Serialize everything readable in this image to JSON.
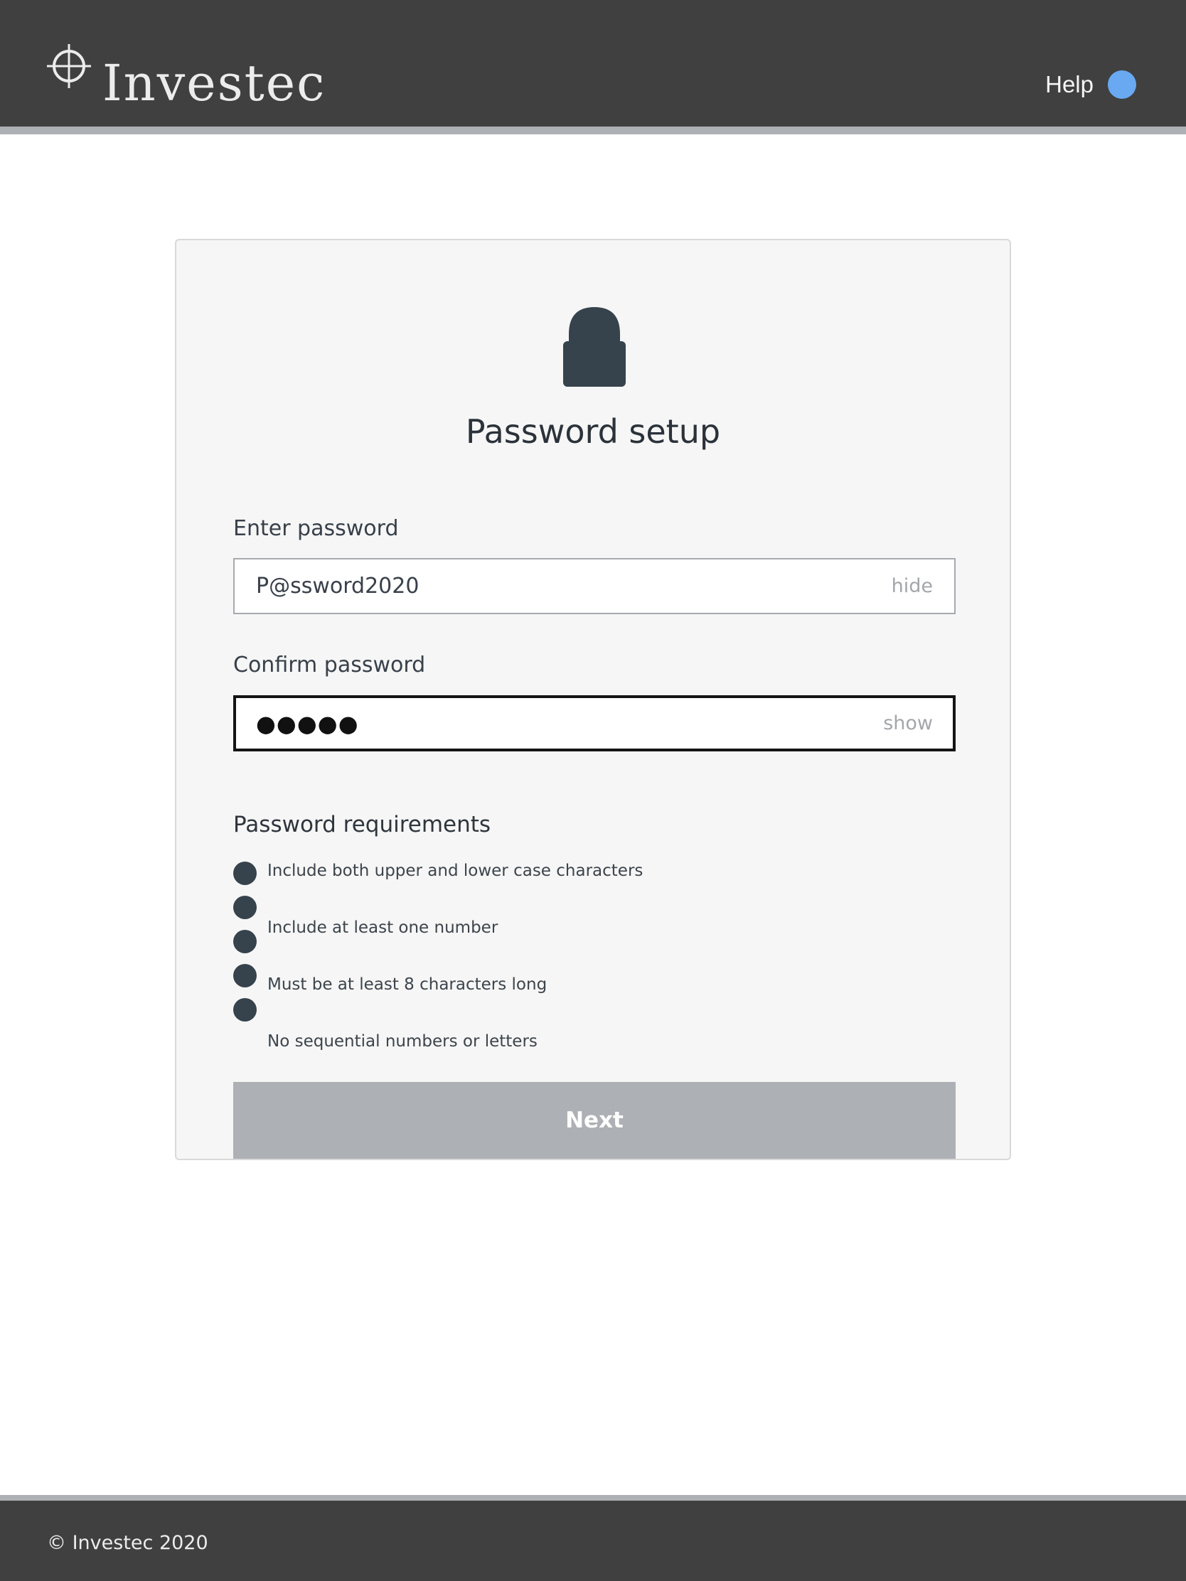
{
  "header": {
    "brand": "Investec",
    "help_label": "Help",
    "help_icon": "info-dot",
    "accent": "#69a9f2"
  },
  "card": {
    "icon": "lock-icon",
    "title": "Password setup",
    "password": {
      "label": "Enter password",
      "value": "P@ssword2020",
      "toggle": "hide"
    },
    "confirm": {
      "label": "Confirm password",
      "value": "●●●●●",
      "toggle": "show"
    },
    "requirements": {
      "title": "Password requirements",
      "items": [
        "Include both upper and lower case characters",
        "Include at least one number",
        "Must be at least 8 characters long",
        "No sequential numbers or letters"
      ]
    },
    "next_label": "Next"
  },
  "footer": {
    "copyright": "© Investec 2020"
  }
}
